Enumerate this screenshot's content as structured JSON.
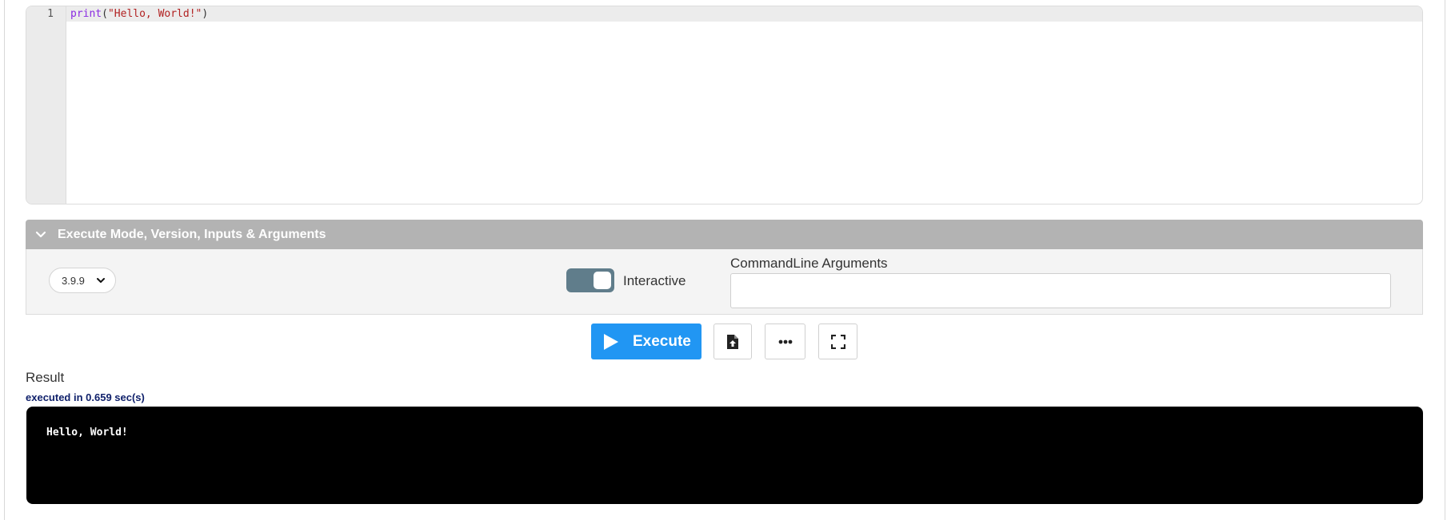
{
  "editor": {
    "line_number": "1",
    "code": {
      "fn": "print",
      "open": "(",
      "str": "\"Hello, World!\"",
      "close": ")"
    }
  },
  "options_panel": {
    "title": "Execute Mode, Version, Inputs & Arguments",
    "version": "3.9.9",
    "interactive_label": "Interactive",
    "interactive_on": true,
    "args_label": "CommandLine Arguments",
    "args_value": ""
  },
  "toolbar": {
    "execute_label": "Execute",
    "icons": [
      "play-icon",
      "file-upload-icon",
      "more-options-icon",
      "fullscreen-icon"
    ]
  },
  "result": {
    "label": "Result",
    "exec_time": "executed in 0.659 sec(s)",
    "output": "Hello, World!"
  },
  "colors": {
    "accent": "#2196f3",
    "panel_header": "#b3b3b3",
    "toggle": "#607d8b",
    "exec_time": "#10216b"
  }
}
